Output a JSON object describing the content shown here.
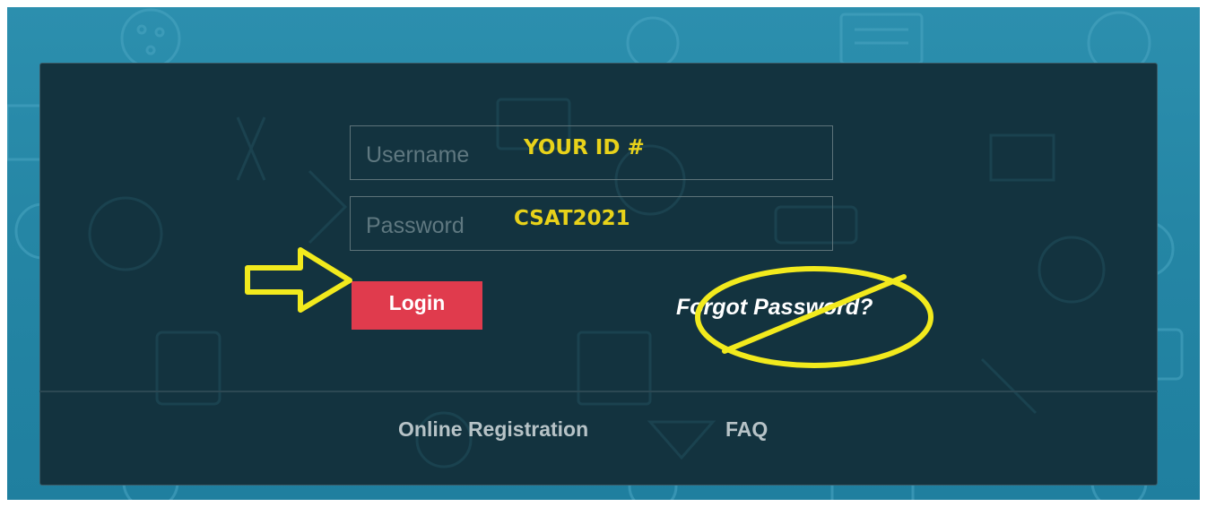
{
  "login_form": {
    "username_placeholder": "Username",
    "username_annotation": "YOUR ID #",
    "password_placeholder": "Password",
    "password_annotation": "CSAT2021",
    "login_label": "Login",
    "forgot_password_label": "Forgot Password?"
  },
  "footer": {
    "online_registration_label": "Online Registration",
    "faq_label": "FAQ"
  },
  "annotations": {
    "arrow_icon": "arrow-right-icon",
    "prohibited_icon": "prohibited-icon",
    "highlight_color": "#f2ea1d"
  },
  "colors": {
    "background": "#2586a5",
    "panel": "#13333f",
    "login_button": "#e03b4d",
    "annotation_text": "#e8d21a"
  }
}
